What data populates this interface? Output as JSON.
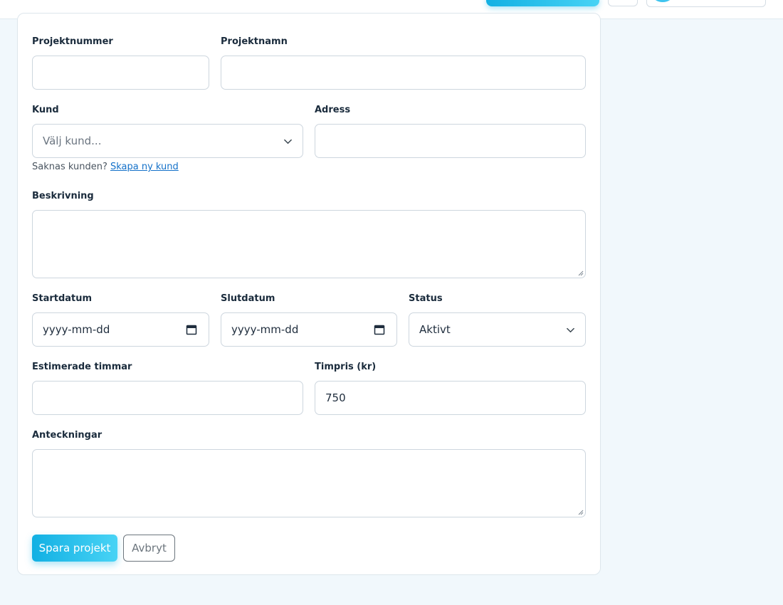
{
  "form": {
    "project_number": {
      "label": "Projektnummer",
      "value": ""
    },
    "project_name": {
      "label": "Projektnamn",
      "value": ""
    },
    "customer": {
      "label": "Kund",
      "placeholder": "Välj kund..."
    },
    "customer_helper": {
      "text": "Saknas kunden?",
      "link": "Skapa ny kund"
    },
    "address": {
      "label": "Adress",
      "value": ""
    },
    "description": {
      "label": "Beskrivning",
      "value": ""
    },
    "start_date": {
      "label": "Startdatum",
      "placeholder": "yyyy-mm-dd"
    },
    "end_date": {
      "label": "Slutdatum",
      "placeholder": "yyyy-mm-dd"
    },
    "status": {
      "label": "Status",
      "value": "Aktivt"
    },
    "estimated_hours": {
      "label": "Estimerade timmar",
      "value": ""
    },
    "hourly_rate": {
      "label": "Timpris (kr)",
      "value": "750"
    },
    "notes": {
      "label": "Anteckningar",
      "value": ""
    }
  },
  "actions": {
    "save_label": "Spara projekt",
    "cancel_label": "Avbryt"
  },
  "icons": {
    "select": "chevron-down-icon",
    "date": "calendar-icon",
    "resize": "resize-grip-icon"
  },
  "colors": {
    "accent_start": "#12b0e3",
    "accent_end": "#48d3f5",
    "link": "#1471c9",
    "page_bg": "#f1f8fc"
  }
}
